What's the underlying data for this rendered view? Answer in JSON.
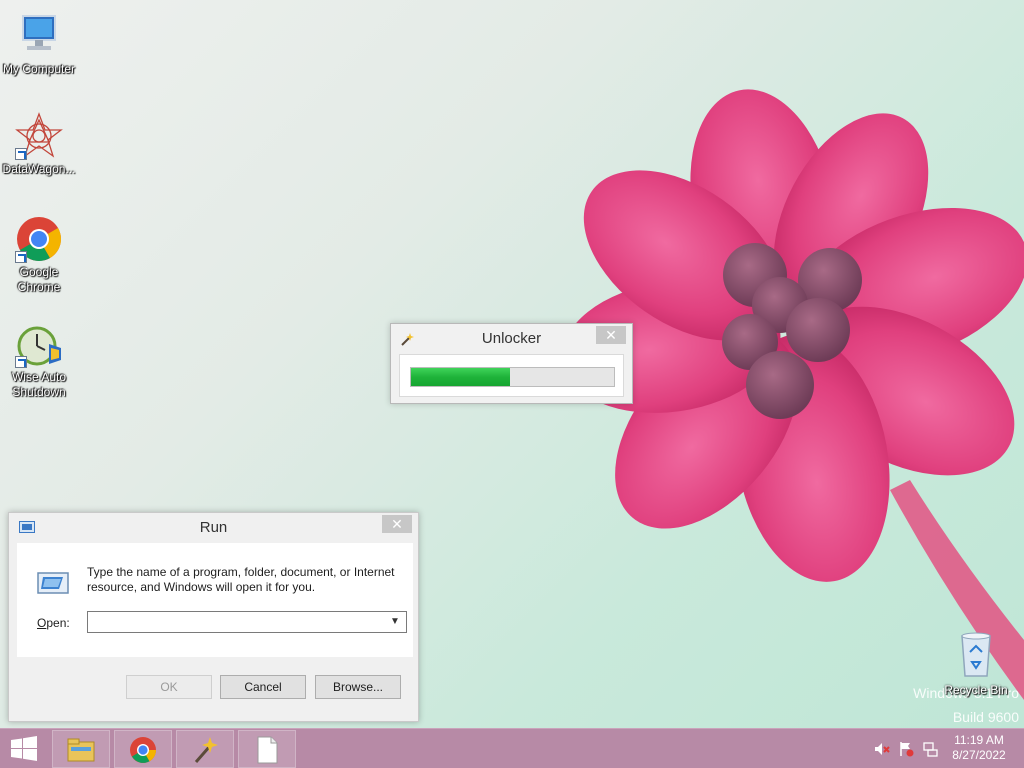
{
  "desktop": {
    "icons": [
      {
        "label": "My Computer",
        "icon": "computer-icon"
      },
      {
        "label": "DataWagon...",
        "icon": "datawagon-icon"
      },
      {
        "label": "Google Chrome",
        "icon": "chrome-icon"
      },
      {
        "label": "Wise Auto Shutdown",
        "icon": "shutdown-clock-icon"
      },
      {
        "label": "Recycle Bin",
        "icon": "recycle-bin-icon"
      }
    ],
    "watermark": {
      "line1": "Windows 8.1 Pro",
      "line2": "Build 9600"
    }
  },
  "unlocker": {
    "title": "Unlocker",
    "progress_fraction": 0.49,
    "close_label": "✕"
  },
  "run_dialog": {
    "title": "Run",
    "description": "Type the name of a program, folder, document, or Internet resource, and Windows will open it for you.",
    "open_label_accel": "O",
    "open_label_rest": "pen:",
    "open_value": "",
    "buttons": {
      "ok": "OK",
      "cancel": "Cancel",
      "browse": "Browse..."
    },
    "close_label": "✕"
  },
  "taskbar": {
    "pinned": [
      "file-explorer-icon",
      "chrome-icon",
      "unlocker-wand-icon",
      "blank-document-icon"
    ],
    "tray": [
      "volume-muted-icon",
      "action-center-flag-icon",
      "network-icon"
    ],
    "time": "11:19 AM",
    "date": "8/27/2022"
  },
  "colors": {
    "taskbar": "#b78aa6",
    "progress": "#1fb33a",
    "wallpaper": "#c9e9db",
    "flower": "#e0407e"
  }
}
